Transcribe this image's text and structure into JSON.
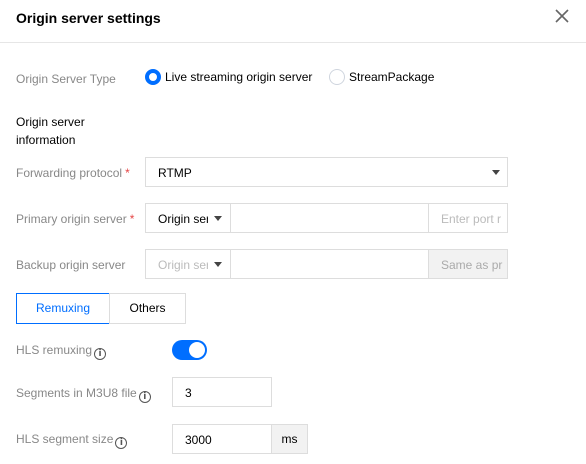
{
  "dialog": {
    "title": "Origin server settings",
    "close_icon": "close-icon"
  },
  "origin_type": {
    "label": "Origin Server Type",
    "options": [
      {
        "label": "Live streaming origin server",
        "selected": true
      },
      {
        "label": "StreamPackage",
        "selected": false
      }
    ]
  },
  "section": {
    "label": "Origin server information"
  },
  "forwarding": {
    "label": "Forwarding protocol",
    "required_mark": "*",
    "value": "RTMP"
  },
  "primary": {
    "label": "Primary origin server",
    "required_mark": "*",
    "select_value": "Origin ser",
    "address_value": "",
    "port_placeholder": "Enter port r"
  },
  "backup": {
    "label": "Backup origin server",
    "select_placeholder": "Origin ser",
    "address_value": "",
    "port_placeholder": "Same as pr"
  },
  "tabs": [
    {
      "label": "Remuxing",
      "active": true
    },
    {
      "label": "Others",
      "active": false
    }
  ],
  "hls_remuxing": {
    "label": "HLS remuxing",
    "enabled": true
  },
  "segments": {
    "label": "Segments in M3U8 file",
    "value": "3"
  },
  "segment_size": {
    "label": "HLS segment size",
    "value": "3000",
    "unit": "ms"
  },
  "colors": {
    "accent": "#006eff",
    "required": "#e54545",
    "muted_label": "#888888",
    "border": "#dddddd",
    "disabled_bg": "#f2f2f2"
  }
}
